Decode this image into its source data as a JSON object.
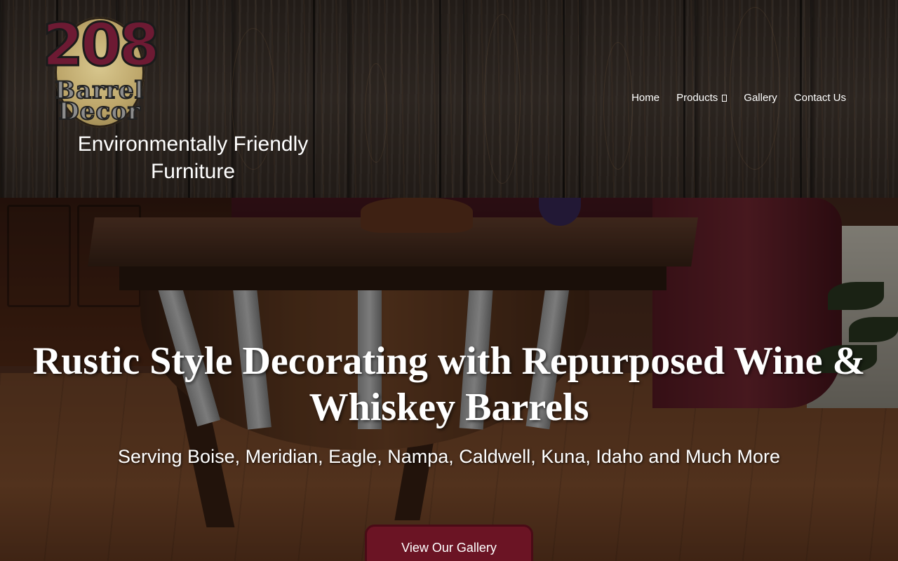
{
  "brand": {
    "logo_number": "208",
    "logo_word_1": "Barrel",
    "logo_word_2": "Decor",
    "tagline": "Environmentally Friendly Furniture"
  },
  "nav": {
    "items": [
      {
        "label": "Home"
      },
      {
        "label": "Products",
        "icon": "dropdown-caret-icon"
      },
      {
        "label": "Gallery"
      },
      {
        "label": "Contact Us"
      }
    ]
  },
  "hero": {
    "title": "Rustic Style Decorating with Repurposed Wine & Whiskey Barrels",
    "subtitle": "Serving Boise, Meridian, Eagle, Nampa, Caldwell, Kuna, Idaho and Much More",
    "cta_label": "View Our Gallery"
  },
  "colors": {
    "accent": "#6b1424",
    "logo_primary": "#6d1a33",
    "logo_disc": "#bda66a"
  }
}
